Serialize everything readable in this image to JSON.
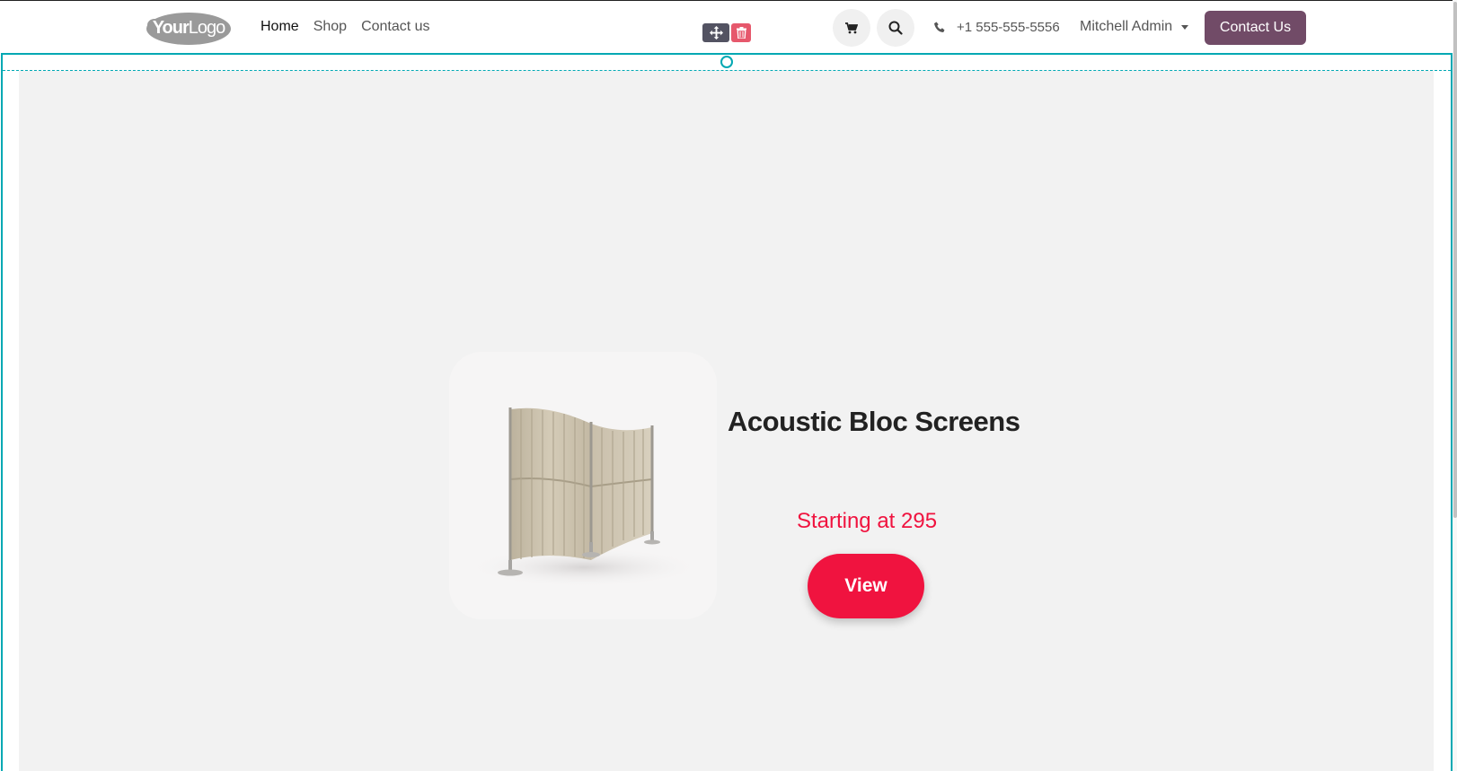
{
  "header": {
    "logo": {
      "text_bold": "Your",
      "text_light": "Logo"
    },
    "nav": [
      {
        "label": "Home",
        "active": true
      },
      {
        "label": "Shop",
        "active": false
      },
      {
        "label": "Contact us",
        "active": false
      }
    ],
    "cart_icon": "cart-icon",
    "search_icon": "search-icon",
    "phone_icon": "phone-icon",
    "phone": "+1 555-555-5556",
    "user": "Mitchell Admin",
    "contact_button": "Contact Us"
  },
  "editor": {
    "move_icon": "move-icon",
    "delete_icon": "trash-icon",
    "selection_color": "#00a8b3"
  },
  "product": {
    "title": "Acoustic Bloc Screens",
    "price_text": "Starting at 295",
    "view_label": "View",
    "image": "acoustic-screen-image"
  },
  "colors": {
    "brand": "#714b67",
    "accent": "#f0133f",
    "section_bg": "#f2f2f2"
  }
}
